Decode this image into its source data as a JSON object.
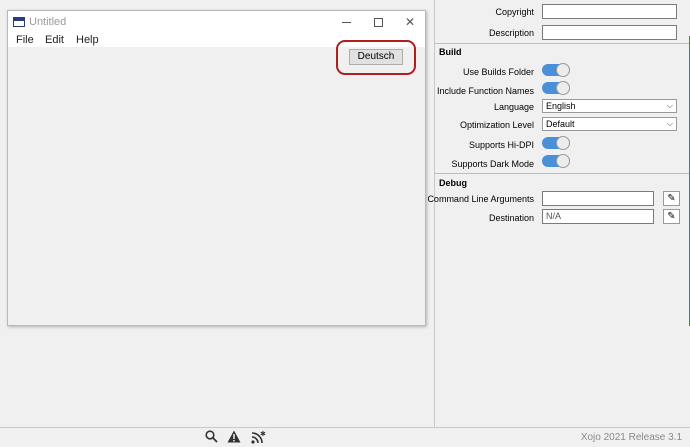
{
  "window": {
    "title": "Untitled",
    "menus": [
      "File",
      "Edit",
      "Help"
    ],
    "button_label": "Deutsch"
  },
  "inspector": {
    "top_rows": [
      {
        "label": "Copyright",
        "value": ""
      },
      {
        "label": "Description",
        "value": ""
      }
    ],
    "build": {
      "header": "Build",
      "use_builds_folder": "Use Builds Folder",
      "include_function_names": "Include Function Names",
      "language_label": "Language",
      "language_value": "English",
      "optimization_label": "Optimization Level",
      "optimization_value": "Default",
      "supports_hidpi": "Supports Hi-DPI",
      "supports_dark_mode": "Supports Dark Mode"
    },
    "debug": {
      "header": "Debug",
      "cmd_args_label": "Command Line Arguments",
      "cmd_args_value": "",
      "destination_label": "Destination",
      "destination_value": "N/A"
    }
  },
  "statusbar": {
    "version": "Xojo 2021 Release 3.1",
    "icons": [
      "search-icon",
      "warning-icon",
      "feed-icon"
    ]
  },
  "colors": {
    "toggle_on": "#4a90d9",
    "highlight_ring": "#b01e1e"
  }
}
